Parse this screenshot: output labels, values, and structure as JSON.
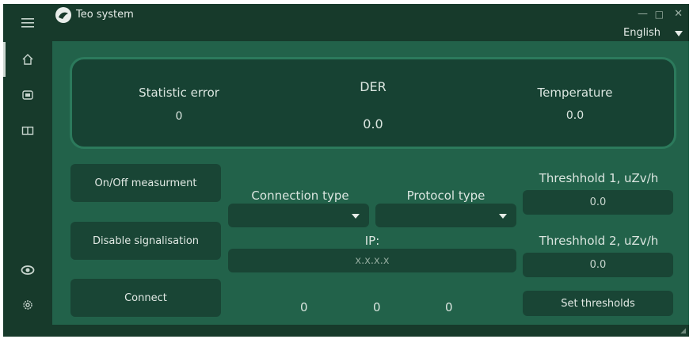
{
  "window": {
    "title": "Teo system",
    "minimize": "—",
    "maximize": "□",
    "close": "✕"
  },
  "language": {
    "selected": "English"
  },
  "sidebar": {
    "icons": [
      "menu-icon",
      "home-icon",
      "radiation-icon",
      "book-icon",
      "eye-icon",
      "gear-icon"
    ]
  },
  "dashboard": {
    "statistic_error": {
      "label": "Statistic error",
      "value": "0"
    },
    "der": {
      "label": "DER",
      "value": "0.0"
    },
    "temperature": {
      "label": "Temperature",
      "value": "0.0"
    }
  },
  "controls": {
    "onoff_label": "On/Off measurment",
    "disable_label": "Disable signalisation",
    "connect_label": "Connect"
  },
  "connection": {
    "connection_type_label": "Connection type",
    "connection_type_value": "",
    "protocol_type_label": "Protocol type",
    "protocol_type_value": "",
    "ip_label": "IP:",
    "ip_placeholder": "x.x.x.x",
    "counters": [
      "0",
      "0",
      "0"
    ]
  },
  "thresholds": {
    "t1_label": "Threshhold 1, uZv/h",
    "t1_value": "0.0",
    "t2_label": "Threshhold 2, uZv/h",
    "t2_value": "0.0",
    "set_label": "Set thresholds"
  }
}
